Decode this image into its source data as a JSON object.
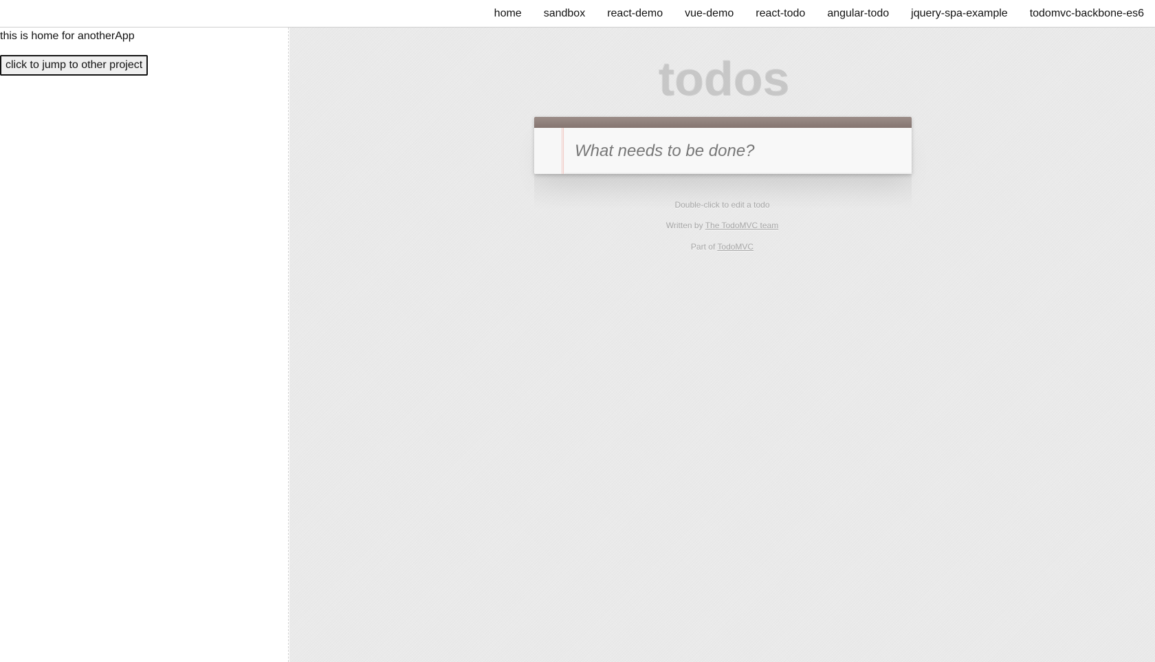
{
  "nav": {
    "links": [
      "home",
      "sandbox",
      "react-demo",
      "vue-demo",
      "react-todo",
      "angular-todo",
      "jquery-spa-example",
      "todomvc-backbone-es6"
    ]
  },
  "left": {
    "text": "this is home for anotherApp",
    "button_label": "click to jump to other project"
  },
  "todo": {
    "title": "todos",
    "input_placeholder": "What needs to be done?",
    "info_edit": "Double-click to edit a todo",
    "written_by_prefix": "Written by ",
    "written_by_link": "The TodoMVC team",
    "part_of_prefix": "Part of ",
    "part_of_link": "TodoMVC"
  },
  "colors": {
    "header_bar": "#8f807b",
    "background": "#eaeaea",
    "title": "#c8c8c8"
  }
}
